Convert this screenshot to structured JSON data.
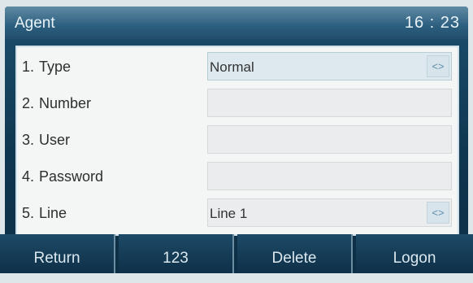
{
  "header": {
    "title": "Agent",
    "time": "16 : 23"
  },
  "fields": [
    {
      "number": "1.",
      "label": "Type",
      "value": "Normal",
      "arrows": "<>"
    },
    {
      "number": "2.",
      "label": "Number",
      "value": ""
    },
    {
      "number": "3.",
      "label": "User",
      "value": ""
    },
    {
      "number": "4.",
      "label": "Password",
      "value": ""
    },
    {
      "number": "5.",
      "label": "Line",
      "value": "Line 1",
      "arrows": "<>"
    }
  ],
  "softkeys": [
    "Return",
    "123",
    "Delete",
    "Logon"
  ]
}
